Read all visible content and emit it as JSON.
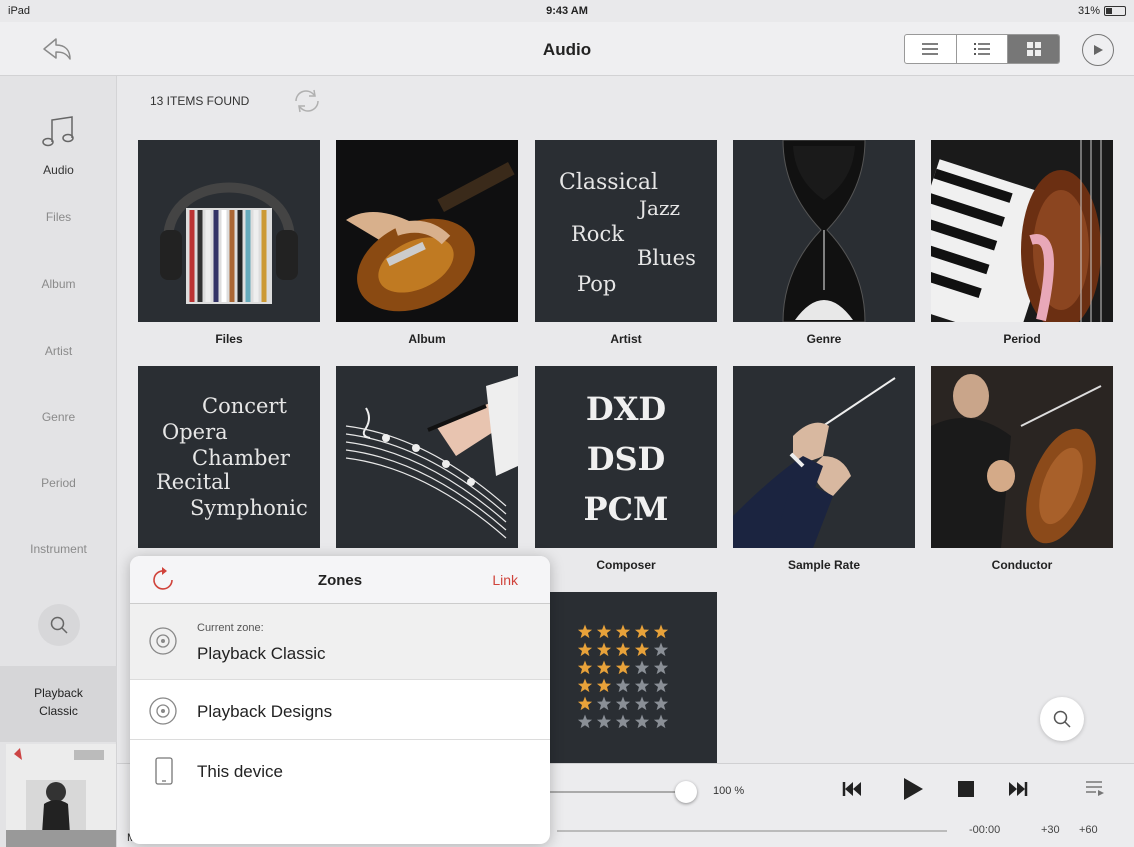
{
  "statusbar": {
    "device": "iPad",
    "time": "9:43 AM",
    "battery": "31%",
    "battery_level": 0.31
  },
  "header": {
    "title": "Audio",
    "back_icon": "back-arrow-icon",
    "view_modes": [
      "list-compact-icon",
      "list-detail-icon",
      "grid-icon"
    ],
    "selected_view": "grid-icon",
    "play_icon": "play-circle-icon"
  },
  "sidebar": {
    "items": [
      {
        "label": "Audio",
        "active": true
      },
      {
        "label": "Files"
      },
      {
        "label": "Album"
      },
      {
        "label": "Artist"
      },
      {
        "label": "Genre"
      },
      {
        "label": "Period"
      },
      {
        "label": "Instrument"
      }
    ],
    "zone_line1": "Playback",
    "zone_line2": "Classic"
  },
  "content": {
    "count": "13 ITEMS FOUND",
    "tiles": [
      {
        "label": "Files"
      },
      {
        "label": "Album"
      },
      {
        "label": "Artist",
        "words": [
          "Classical",
          "Jazz",
          "Rock",
          "Blues",
          "Pop"
        ]
      },
      {
        "label": "Genre"
      },
      {
        "label": "Period"
      },
      {
        "label": "",
        "words": [
          "Concert",
          "Opera",
          "Chamber",
          "Recital",
          "Symphonic"
        ]
      },
      {
        "label": ""
      },
      {
        "label": "Composer",
        "words": [
          "DXD",
          "DSD",
          "PCM"
        ]
      },
      {
        "label": "Sample Rate"
      },
      {
        "label": "Conductor"
      },
      {
        "label": "",
        "rating_rows": [
          5,
          4,
          3,
          2,
          1,
          0
        ]
      }
    ]
  },
  "zones": {
    "title": "Zones",
    "link": "Link",
    "current_caption": "Current zone:",
    "current": "Playback Classic",
    "others": [
      "Playback Designs",
      "This device"
    ]
  },
  "player": {
    "volume": "100 %",
    "volume_level": 1.0,
    "time": "-00:00",
    "skip_back": "+30",
    "skip_fwd": "+60",
    "track_fragment": "Major"
  },
  "colors": {
    "accent": "#d0433b",
    "tile_bg": "#2a2e33",
    "star": "#e8a23a"
  }
}
